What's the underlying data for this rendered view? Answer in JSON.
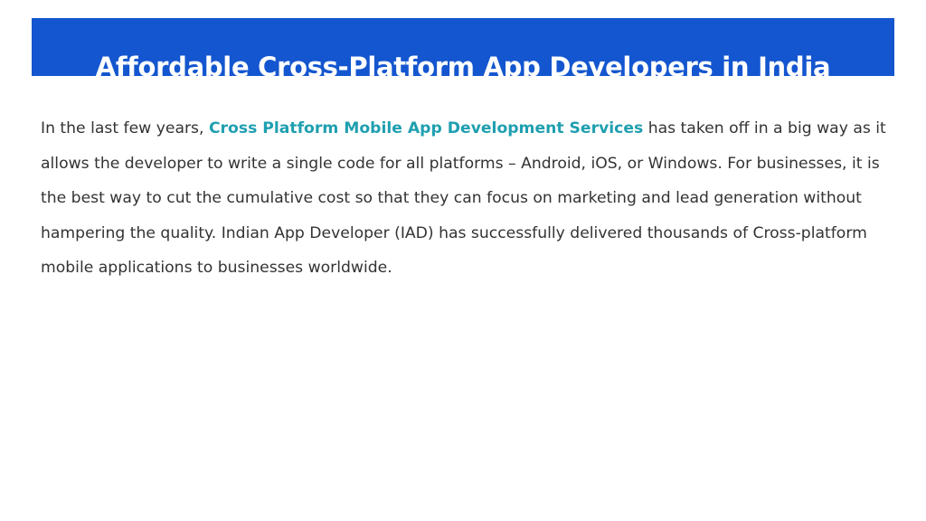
{
  "slide": {
    "title": "Affordable Cross-Platform App Developers in India",
    "paragraph": {
      "intro": "In the last few years, ",
      "highlight": "Cross Platform Mobile App Development Services",
      "rest": " has taken off in a big way as it allows the developer to write a single code for all platforms – Android, iOS, or Windows. For businesses, it is the best way to cut the cumulative cost so that they can focus on marketing and lead generation without hampering the quality. Indian App Developer (IAD) has successfully delivered thousands of Cross-platform mobile applications to businesses worldwide."
    }
  },
  "colors": {
    "banner": "#1456cf",
    "highlight": "#1f9fb0",
    "text": "#333333"
  }
}
